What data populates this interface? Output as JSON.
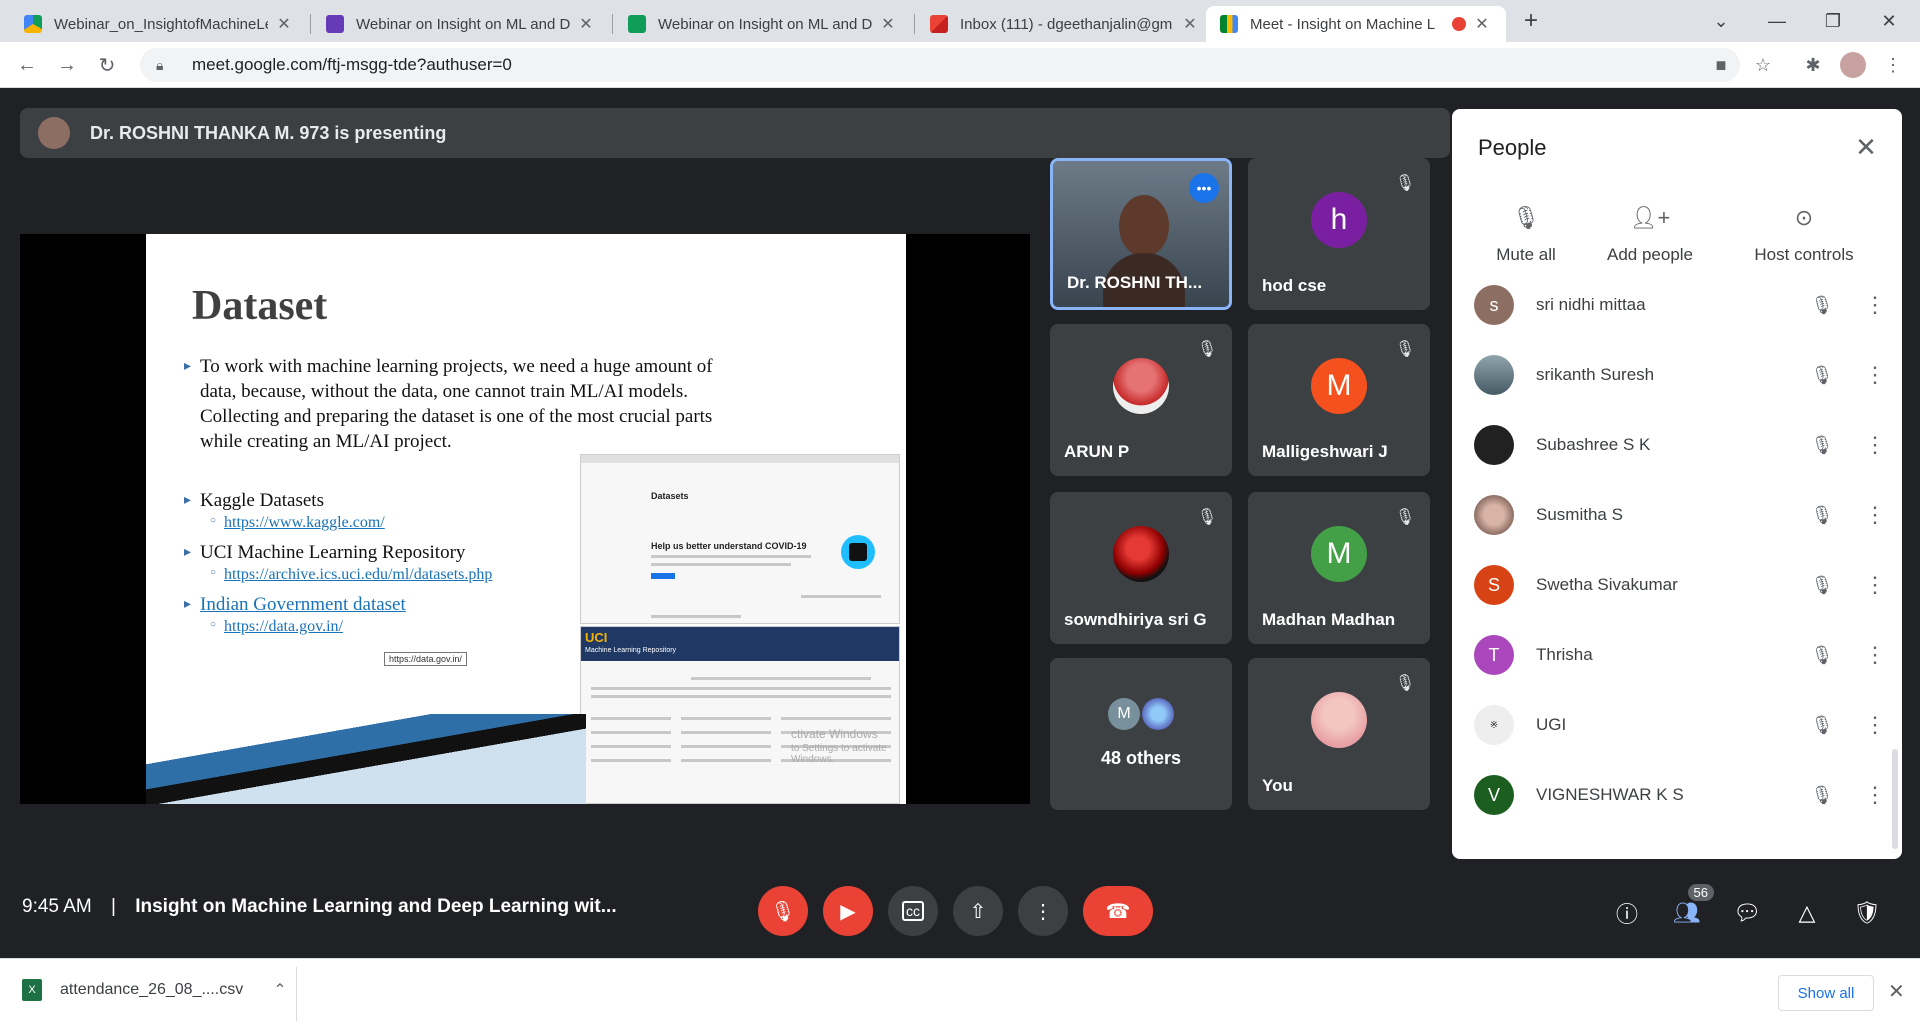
{
  "browser": {
    "tabs": [
      {
        "title": "Webinar_on_InsightofMachineLe",
        "icon_color": "#4285f4"
      },
      {
        "title": "Webinar on Insight on ML and D",
        "icon_color": "#673ab7"
      },
      {
        "title": "Webinar on Insight on ML and D",
        "icon_color": "#0f9d58"
      },
      {
        "title": "Inbox (111) - dgeethanjalin@gm",
        "icon_color": "#ea4335"
      },
      {
        "title": "Meet - Insight on Machine L",
        "icon_color": "#00832d"
      }
    ],
    "new_tab": "+",
    "url": "meet.google.com/ftj-msgg-tde?authuser=0"
  },
  "meet": {
    "presenting_banner": "Dr. ROSHNI THANKA M. 973 is presenting",
    "slide": {
      "title": "Dataset",
      "bullets": [
        "To work with machine learning projects, we need a huge amount of",
        "data, because, without the data, one cannot train ML/AI models.",
        "Collecting and preparing the dataset is one of the most crucial parts",
        "while creating an ML/AI project."
      ],
      "items": [
        {
          "label": "Kaggle Datasets",
          "link": "https://www.kaggle.com/"
        },
        {
          "label": "UCI Machine Learning Repository",
          "link": "https://archive.ics.uci.edu/ml/datasets.php"
        },
        {
          "label": "Indian Government dataset",
          "link": "https://data.gov.in/"
        }
      ],
      "tooltip": "https://data.gov.in/",
      "kaggle_thumb_heading": "Datasets",
      "kaggle_thumb_card": "Help us better understand COVID-19",
      "uci_thumb_logo": "UCI",
      "uci_thumb_title": "Machine Learning Repository",
      "watermark_line1": "ctivate Windows",
      "watermark_line2": "to Settings to activate Windows."
    },
    "tiles": [
      {
        "name": "Dr. ROSHNI TH...",
        "muted": false,
        "avatar": "video"
      },
      {
        "name": "hod cse",
        "muted": true,
        "letter": "h",
        "color": "#7b1fa2"
      },
      {
        "name": "ARUN P",
        "muted": true,
        "avatar": "photo"
      },
      {
        "name": "Malligeshwari J",
        "muted": true,
        "letter": "M",
        "color": "#f4511e"
      },
      {
        "name": "sowndhiriya sri G",
        "muted": true,
        "avatar": "roses"
      },
      {
        "name": "Madhan Madhan",
        "muted": true,
        "letter": "M",
        "color": "#43a047"
      },
      {
        "name": "48 others",
        "muted": false,
        "letter": "M",
        "color": "#78909c"
      },
      {
        "name": "You",
        "muted": true,
        "avatar": "photo"
      }
    ],
    "people_panel": {
      "title": "People",
      "actions": [
        "Mute all",
        "Add people",
        "Host controls"
      ],
      "participants": [
        {
          "name": "sri nidhi mittaa",
          "letter": "s",
          "color": "#8d6e63"
        },
        {
          "name": "srikanth Suresh",
          "letter": "",
          "color": "#607d8b"
        },
        {
          "name": "Subashree S K",
          "letter": "",
          "color": "#212121"
        },
        {
          "name": "Susmitha S",
          "letter": "",
          "color": "#a1887f"
        },
        {
          "name": "Swetha Sivakumar",
          "letter": "S",
          "color": "#d84315"
        },
        {
          "name": "Thrisha",
          "letter": "T",
          "color": "#ab47bc"
        },
        {
          "name": "UGI",
          "letter": "",
          "color": "#eeeeee"
        },
        {
          "name": "VIGNESHWAR K S",
          "letter": "V",
          "color": "#1b5e20"
        }
      ]
    },
    "bottom_bar": {
      "time": "9:45 AM",
      "separator": "|",
      "meeting_title": "Insight on Machine Learning and Deep Learning wit...",
      "participant_count": "56"
    }
  },
  "downloads": {
    "file": "attendance_26_08_....csv",
    "show_all": "Show all"
  },
  "colors": {
    "accent": "#1a73e8",
    "end_call": "#ea4335",
    "muted_button": "#ea4335"
  }
}
